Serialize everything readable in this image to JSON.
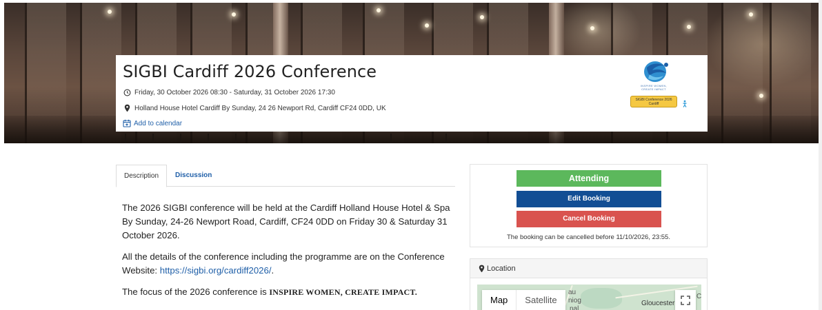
{
  "event": {
    "title": "SIGBI Cardiff 2026 Conference",
    "datetime": "Friday, 30 October 2026 08:30 - Saturday, 31 October 2026 17:30",
    "venue": "Holland House Hotel Cardiff By Sunday, 24 26 Newport Rd, Cardiff CF24 0DD, UK",
    "add_to_calendar": "Add to calendar",
    "logo": {
      "tagline": "INSPIRE WOMEN, CREATE IMPACT",
      "badge": "SIGBI Conference 2026 Cardiff"
    }
  },
  "tabs": [
    {
      "label": "Description",
      "active": true
    },
    {
      "label": "Discussion",
      "active": false
    }
  ],
  "description": {
    "p1": "The 2026 SIGBI conference will be held at the Cardiff Holland House Hotel & Spa By Sunday, 24-26 Newport Road, Cardiff, CF24 0DD on Friday 30 & Saturday 31 October 2026.",
    "p2_text": "All the details of the conference including the programme are on the Conference Website: ",
    "p2_link": "https://sigbi.org/cardiff2026/",
    "p2_tail": ".",
    "p3_text": "The focus of the 2026 conference is ",
    "p3_emph": "INSPIRE WOMEN, CREATE IMPACT."
  },
  "booking": {
    "attending": "Attending",
    "edit": "Edit Booking",
    "cancel": "Cancel Booking",
    "note": "The booking can be cancelled before 11/10/2026, 23:55."
  },
  "location": {
    "heading": "Location",
    "map_type_map": "Map",
    "map_type_satellite": "Satellite",
    "map_label_1": "au",
    "map_label_2": "niog",
    "map_label_3": "nal",
    "map_city": "Gloucester",
    "map_label_4": "C"
  },
  "colors": {
    "attending": "#5cb85c",
    "edit": "#124e94",
    "cancel": "#d9534f",
    "link": "#1f5fa8"
  }
}
